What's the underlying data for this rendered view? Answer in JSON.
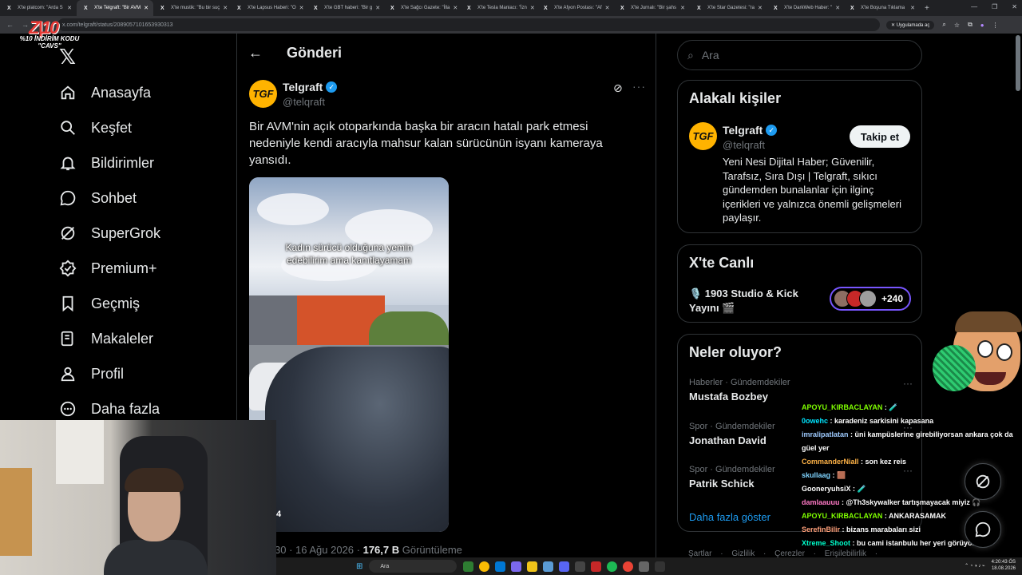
{
  "browser": {
    "tabs": [
      {
        "label": "X'te platcom: \"Arda S"
      },
      {
        "label": "X'te Telgraft: \"Bir AVM",
        "active": true
      },
      {
        "label": "X'te mustik: \"Bu bir suç"
      },
      {
        "label": "X'te Lapsus Haberi: \"O"
      },
      {
        "label": "X'te GBT haberi: \"Bir g"
      },
      {
        "label": "X'te Sağcı Gazete: \"İlla"
      },
      {
        "label": "X'te Tesla Maniacı: \"İzn"
      },
      {
        "label": "X'te Afyon Postası: \"Af"
      },
      {
        "label": "X'te Jurnalı: \"Bir şahs"
      },
      {
        "label": "X'te Star Gazetesi: \"ra"
      },
      {
        "label": "X'te DarkWeb Haber: \""
      },
      {
        "label": "X'te Boşuna Tıklama"
      }
    ],
    "url": "x.com/telgraft/status/2089057101653930313",
    "app_button": "Uygulamada aç"
  },
  "promo": {
    "mark": "Z|10",
    "text_line1": "%10 İNDİRİM KODU",
    "text_line2": "\"CAVS\""
  },
  "nav": {
    "items": [
      {
        "label": "Anasayfa",
        "icon": "home-icon"
      },
      {
        "label": "Keşfet",
        "icon": "search-icon"
      },
      {
        "label": "Bildirimler",
        "icon": "bell-icon"
      },
      {
        "label": "Sohbet",
        "icon": "chat-icon"
      },
      {
        "label": "SuperGrok",
        "icon": "grok-icon"
      },
      {
        "label": "Premium+",
        "icon": "verified-badge-icon"
      },
      {
        "label": "Geçmiş",
        "icon": "bookmark-icon"
      },
      {
        "label": "Makaleler",
        "icon": "article-icon"
      },
      {
        "label": "Profil",
        "icon": "person-icon"
      },
      {
        "label": "Daha fazla",
        "icon": "more-circle-icon"
      }
    ]
  },
  "header": {
    "title": "Gönderi",
    "back_icon": "arrow-left-icon"
  },
  "tweet": {
    "author_name": "Telgraft",
    "author_handle": "@telqraft",
    "avatar_text": "TGF",
    "text": "Bir AVM'nin açık otoparkında başka bir aracın hatalı park etmesi nedeniyle kendi aracıyla mahsur kalan sürücünün isyanı kameraya yansıdı.",
    "media_caption": "Kadın sürücü olduğuna yemin edebilirim ama kanıtlayamam",
    "media_counter": "4",
    "meta_prefix": "30 · 16 Ağu 2026 · ",
    "views": "176,7 B",
    "views_label": " Görüntüleme"
  },
  "search": {
    "placeholder": "Ara"
  },
  "related": {
    "title": "Alakalı kişiler",
    "name": "Telgraft",
    "handle": "@telqraft",
    "avatar_text": "TGF",
    "follow_label": "Takip et",
    "bio": "Yeni Nesi Dijital Haber; Güvenilir, Tarafsız, Sıra Dışı | Telgraft, sıkıcı gündemden bunalanlar için ilginç içerikleri ve yalnızca önemli gelişmeleri paylaşır."
  },
  "live": {
    "title": "X'te Canlı",
    "stream_title": "🎙️ 1903 Studio & Kick Yayını 🎬",
    "count": "+240"
  },
  "trends": {
    "title": "Neler oluyor?",
    "items": [
      {
        "category": "Haberler · Gündemdekiler",
        "name": "Mustafa Bozbey"
      },
      {
        "category": "Spor · Gündemdekiler",
        "name": "Jonathan David"
      },
      {
        "category": "Spor · Gündemdekiler",
        "name": "Patrik Schick"
      }
    ],
    "show_more": "Daha fazla göster"
  },
  "footer": "Şartlar · Gizlilik · Çerezler · Erişilebilirlik ·",
  "chat": [
    {
      "user": "APOYU_KIRBACLAYAN",
      "color": "#7fff00",
      "msg": " : 🧪"
    },
    {
      "user": "0owehc",
      "color": "#00e5ff",
      "msg": " : karadeniz sarkisini kapasana"
    },
    {
      "user": "imralipatlatan",
      "color": "#9ecbff",
      "msg": " : üni kampüslerine girebiliyorsan ankara çok da güel yer"
    },
    {
      "user": "CommanderNiall",
      "color": "#ffb347",
      "msg": " : son kez reis"
    },
    {
      "user": "skullaag",
      "color": "#7fd4ff",
      "msg": " : 🟫"
    },
    {
      "user": "GooneryuhsiX",
      "color": "#ffffff",
      "msg": " : 🧪"
    },
    {
      "user": "damlaauuu",
      "color": "#ff79c6",
      "msg": " : @Th3skywalker tartışmayacak miyiz 🎧"
    },
    {
      "user": "APOYU_KIRBACLAYAN",
      "color": "#7fff00",
      "msg": " : ANKARASAMAK"
    },
    {
      "user": "SerefinBilir",
      "color": "#ffa07a",
      "msg": " : bizans marabaları sizi"
    },
    {
      "user": "Xtreme_Shoot",
      "color": "#00ffcc",
      "msg": " : bu cami istanbulu her yeri görüyor."
    }
  ],
  "taskbar": {
    "search_placeholder": "Ara",
    "time": "4:20:43 ÖS",
    "date": "18.08.2026"
  },
  "colors": {
    "accent": "#1d9bf0",
    "live_border": "#7856ff",
    "brand_avatar": "#ffb300"
  }
}
